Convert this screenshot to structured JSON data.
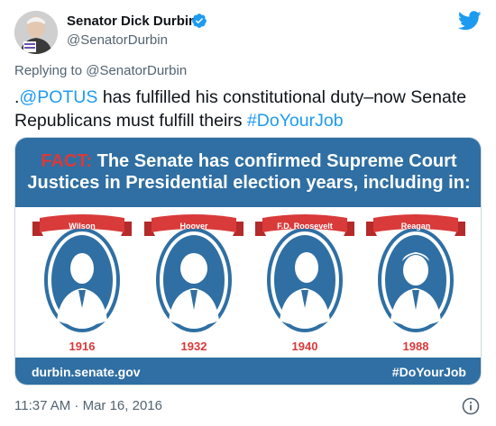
{
  "author": {
    "name": "Senator Dick Durbin",
    "handle": "@SenatorDurbin"
  },
  "reply": {
    "prefix": "Replying to ",
    "mention": "@SenatorDurbin"
  },
  "tweet": {
    "lead": ".",
    "mention": "@POTUS",
    "body": " has fulfilled his constitutional duty–now Senate Republicans must fulfill theirs ",
    "hashtag": "#DoYourJob"
  },
  "card": {
    "fact_label": "FACT:",
    "headline_1": " The Senate has confirmed Supreme Court",
    "headline_2": "Justices in Presidential election years, including in:",
    "footer_left": "durbin.senate.gov",
    "footer_right": "#DoYourJob",
    "presidents": [
      {
        "name": "Wilson",
        "year": "1916"
      },
      {
        "name": "Hoover",
        "year": "1932"
      },
      {
        "name": "F.D. Roosevelt",
        "year": "1940"
      },
      {
        "name": "Reagan",
        "year": "1988"
      }
    ]
  },
  "meta": {
    "timestamp": "11:37 AM · Mar 16, 2016"
  },
  "colors": {
    "brand_blue": "#2f6fa3",
    "fact_red": "#d93a3a",
    "link_blue": "#1d9bf0",
    "twitter_blue": "#1d9bf0"
  },
  "icons": {
    "verified": "verified-badge-icon",
    "twitter": "twitter-bird-icon",
    "info": "info-icon"
  }
}
